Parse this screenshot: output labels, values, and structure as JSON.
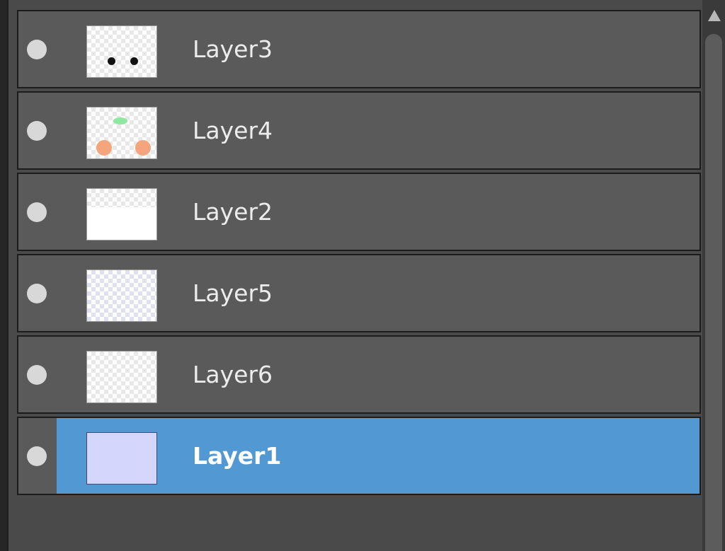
{
  "layers": [
    {
      "name": "Layer3",
      "selected": false,
      "thumbnail": "two-black-dots"
    },
    {
      "name": "Layer4",
      "selected": false,
      "thumbnail": "green-and-orange-dots"
    },
    {
      "name": "Layer2",
      "selected": false,
      "thumbnail": "white-fill"
    },
    {
      "name": "Layer5",
      "selected": false,
      "thumbnail": "light-grid"
    },
    {
      "name": "Layer6",
      "selected": false,
      "thumbnail": "transparent"
    },
    {
      "name": "Layer1",
      "selected": true,
      "thumbnail": "lavender-fill"
    }
  ],
  "colors": {
    "selection": "#5299d3",
    "row_background": "#5a5a5a",
    "panel_background": "#4a4a4a",
    "lavender_fill": "#d4d6fb",
    "orange_dot": "#f4a57e",
    "green_dot": "#8fe8a0",
    "black_dot": "#111111"
  },
  "icons": {
    "visibility": "visibility-dot-icon",
    "scroll_up": "scroll-up-arrow-icon"
  }
}
